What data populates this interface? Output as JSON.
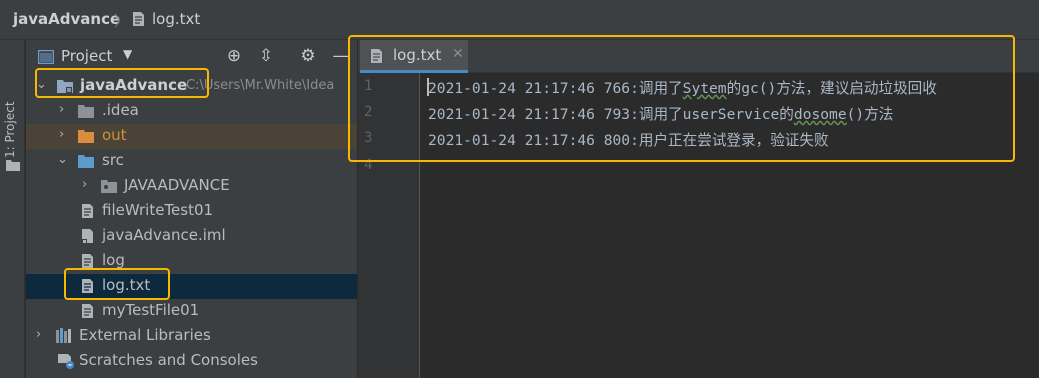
{
  "breadcrumb": {
    "project": "javaAdvance",
    "file": "log.txt"
  },
  "left_stripe": {
    "label": "1: Project"
  },
  "project_panel": {
    "title": "Project",
    "icons": [
      "locate-icon",
      "collapse-icon",
      "settings-icon",
      "hide-icon"
    ]
  },
  "tree": {
    "root": {
      "name": "javaAdvance",
      "path": "C:\\Users\\Mr.White\\Idea"
    },
    "idea": ".idea",
    "out": "out",
    "src": "src",
    "javaadvance": "JAVAADVANCE",
    "filewrite": "fileWriteTest01",
    "iml": "javaAdvance.iml",
    "log": "log",
    "logtxt": "log.txt",
    "mytest": "myTestFile01",
    "extlibs": "External Libraries",
    "scratches": "Scratches and Consoles"
  },
  "editor": {
    "tab_label": "log.txt",
    "line_numbers": [
      "1",
      "2",
      "3",
      "4"
    ],
    "lines": {
      "l1a": "2021-01-24 21:17:46 766:调用了",
      "l1b": "Sytem",
      "l1c": "的gc()方法，建议启动垃圾回收",
      "l2a": "2021-01-24 21:17:46 793:调用了userService的",
      "l2b": "dosome",
      "l2c": "()方法",
      "l3": "2021-01-24 21:17:46 800:用户正在尝试登录，验证失败"
    }
  },
  "colors": {
    "highlight": "#f6b900",
    "selection": "#0d293e",
    "accent": "#4a88c7"
  }
}
